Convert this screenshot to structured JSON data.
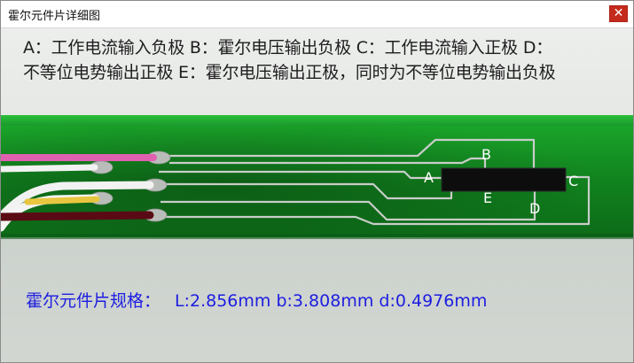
{
  "window": {
    "title": "霍尔元件片详细图",
    "close_glyph": "✕"
  },
  "description": {
    "line1": "A：工作电流输入负极 B：霍尔电压输出负极 C：工作电流输入正极 D：",
    "line2": "不等位电势输出正极 E：霍尔电压输出正极，同时为不等位电势输出负极"
  },
  "pins": {
    "a": "A",
    "b": "B",
    "c": "C",
    "d": "D",
    "e": "E"
  },
  "spec": {
    "title": "霍尔元件片规格：",
    "L": "L:2.856mm",
    "b": "b:3.808mm",
    "d": "d:0.4976mm"
  },
  "colors": {
    "board": "#1f9e2a",
    "wire_pink": "#e060b0",
    "wire_white": "#f2f2f2",
    "wire_yellow": "#e8c640",
    "wire_darkred": "#5a0a14",
    "spec_text": "#1d1de0"
  }
}
